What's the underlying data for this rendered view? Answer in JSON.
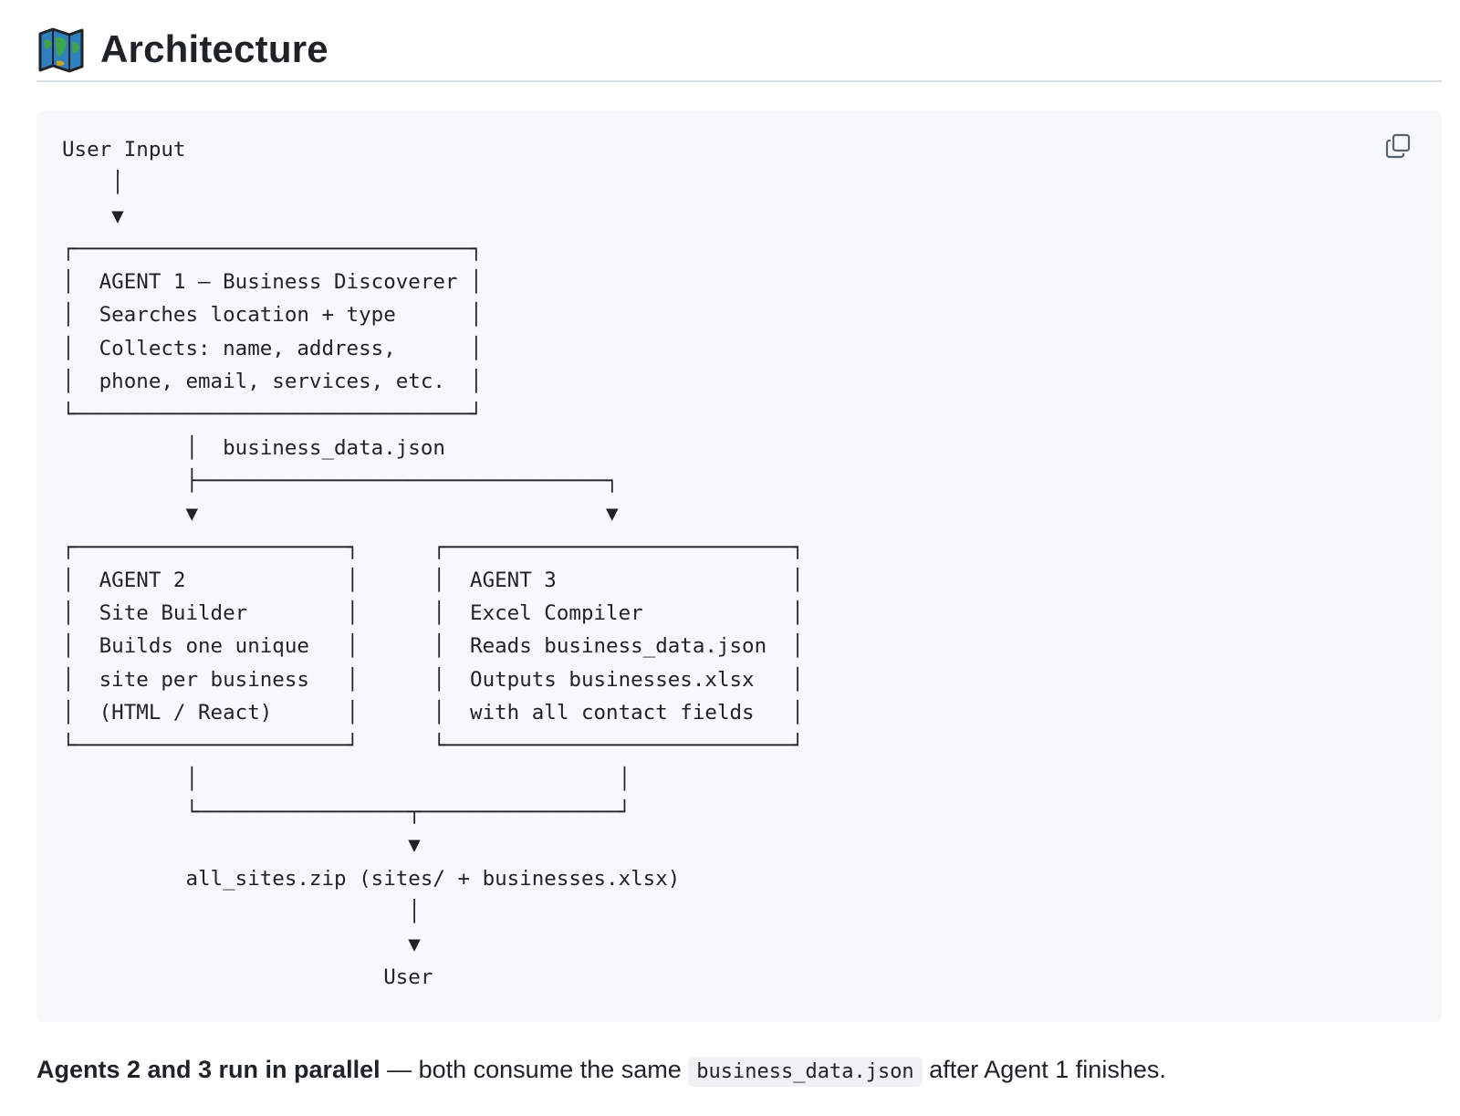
{
  "heading": {
    "icon": "map-icon",
    "title": "Architecture"
  },
  "code_block": {
    "copy_icon": "copy-icon",
    "lines": [
      "User Input",
      "    │",
      "    ▼",
      "┌────────────────────────────────┐",
      "│  AGENT 1 — Business Discoverer │",
      "│  Searches location + type      │",
      "│  Collects: name, address,      │",
      "│  phone, email, services, etc.  │",
      "└────────────────────────────────┘",
      "          │  business_data.json",
      "          ├─────────────────────────────────┐",
      "          ▼                                 ▼",
      "┌──────────────────────┐      ┌────────────────────────────┐",
      "│  AGENT 2             │      │  AGENT 3                   │",
      "│  Site Builder        │      │  Excel Compiler            │",
      "│  Builds one unique   │      │  Reads business_data.json  │",
      "│  site per business   │      │  Outputs businesses.xlsx   │",
      "│  (HTML / React)      │      │  with all contact fields   │",
      "└──────────────────────┘      └────────────────────────────┘",
      "          │                                  │",
      "          └─────────────────┬────────────────┘",
      "                            ▼",
      "          all_sites.zip (sites/ + businesses.xlsx)",
      "                            │",
      "                            ▼",
      "                          User"
    ]
  },
  "caption": {
    "bold": "Agents 2 and 3 run in parallel",
    "text_before": " — both consume the same ",
    "code": "business_data.json",
    "text_after": " after Agent 1 finishes."
  }
}
